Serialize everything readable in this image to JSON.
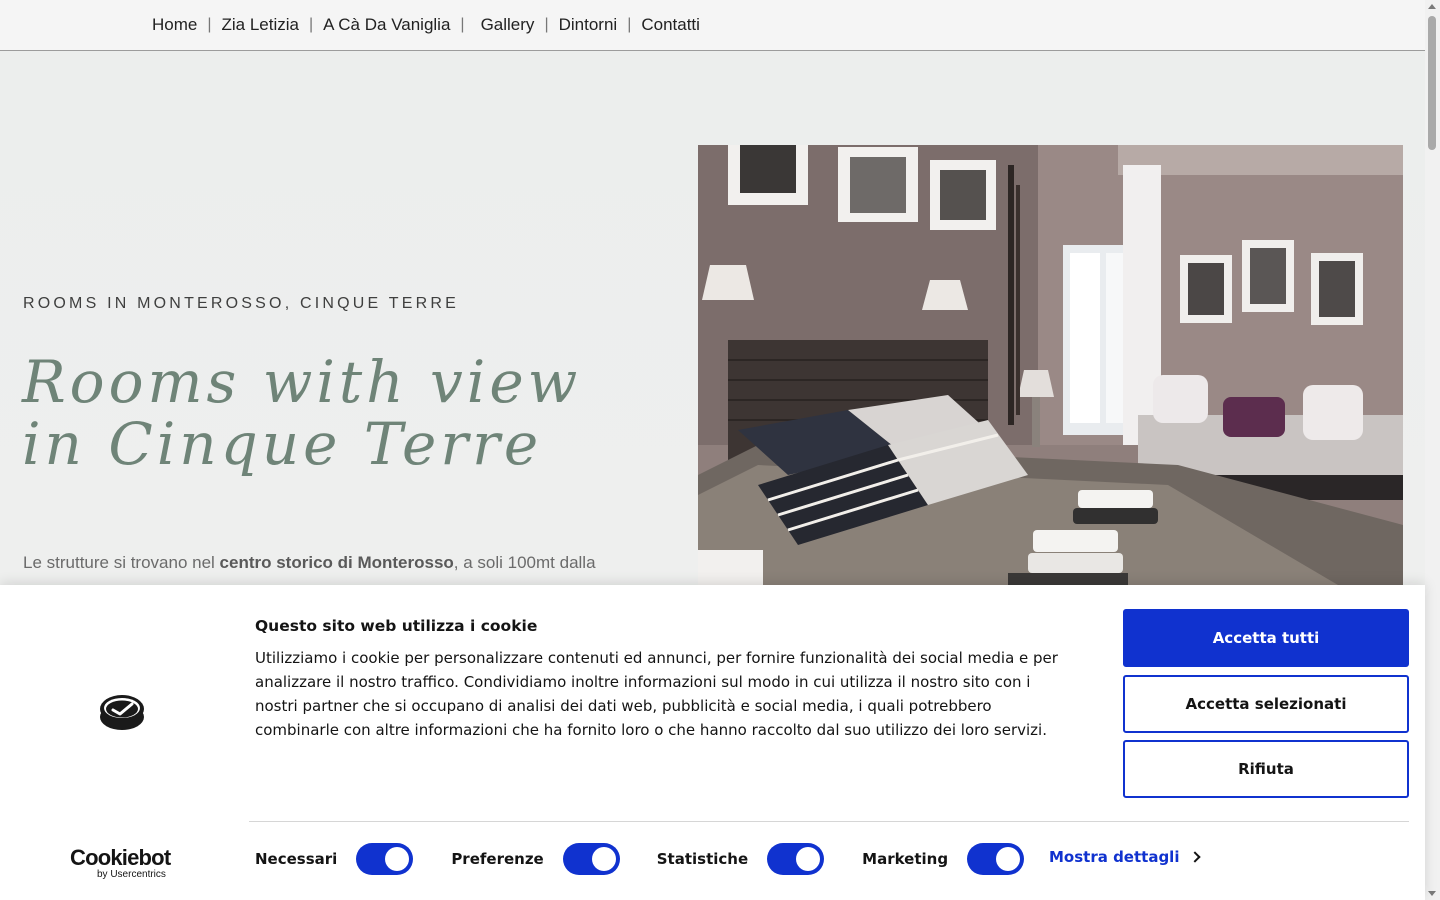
{
  "nav": {
    "items": [
      "Home",
      "Zia Letizia",
      "A Cà Da Vaniglia",
      "Gallery",
      "Dintorni",
      "Contatti"
    ],
    "separator": "|"
  },
  "hero": {
    "eyebrow": "ROOMS IN MONTEROSSO, CINQUE TERRE",
    "headline_line1": "Rooms with view",
    "headline_line2": "in Cinque Terre",
    "text_before": "Le strutture si trovano nel ",
    "text_bold": "centro storico di Monterosso",
    "text_after": ", a soli 100mt dalla"
  },
  "cookie": {
    "title": "Questo sito web utilizza i cookie",
    "body": "Utilizziamo i cookie per personalizzare contenuti ed annunci, per fornire funzionalità dei social media e per analizzare il nostro traffico. Condividiamo inoltre informazioni sul modo in cui utilizza il nostro sito con i nostri partner che si occupano di analisi dei dati web, pubblicità e social media, i quali potrebbero combinarle con altre informazioni che ha fornito loro o che hanno raccolto dal suo utilizzo dei loro servizi.",
    "accept_all": "Accetta tutti",
    "accept_selected": "Accetta selezionati",
    "reject": "Rifiuta",
    "toggles": [
      {
        "label": "Necessari",
        "on": true
      },
      {
        "label": "Preferenze",
        "on": true
      },
      {
        "label": "Statistiche",
        "on": true
      },
      {
        "label": "Marketing",
        "on": true
      }
    ],
    "details": "Mostra dettagli",
    "brand_main": "Cookiebot",
    "brand_sub": "by Usercentrics",
    "accent_color": "#1032cf"
  },
  "colors": {
    "headline": "#6f8478",
    "nav_border": "#9c9c9c"
  }
}
